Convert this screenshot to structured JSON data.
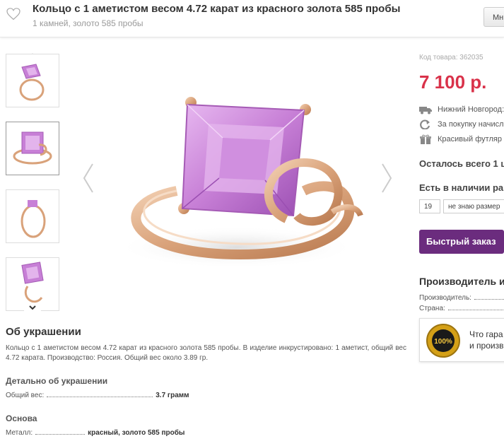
{
  "header": {
    "title": "Кольцо с 1 аметистом весом 4.72 карат из красного золота 585 пробы",
    "subtitle": "1 камней, золото 585 пробы",
    "button_label": "Мн"
  },
  "about": {
    "title": "Об украшении",
    "description": "Кольцо с 1 аметистом весом 4.72 карат из красного золота 585 пробы. В изделие инкрустировано: 1 аметист, общий вес 4.72 карата. Производство: Россия. Общий вес около 3.89 гр.",
    "details_title": "Детально об украшении",
    "weight_label": "Общий вес:",
    "weight_value": "3.7 грамм",
    "base_title": "Основа",
    "metal_label": "Металл:",
    "metal_value": "красный, золото 585 пробы"
  },
  "product": {
    "code": "Код товара: 362035",
    "price": "7 100 р.",
    "features": [
      {
        "icon": "truck-icon",
        "text": "Нижний Новгород:"
      },
      {
        "icon": "refresh-icon",
        "text": "За покупку начисл"
      },
      {
        "icon": "gift-icon",
        "text": "Красивый футляр"
      }
    ],
    "remaining": "Осталось всего 1 ш",
    "availability": "Есть в наличии ра",
    "size_value": "19",
    "size_unknown": "не знаю размер",
    "quick_order": "Быстрый заказ"
  },
  "manufacturer": {
    "title": "Производитель и",
    "producer_label": "Производитель:",
    "country_label": "Страна:"
  },
  "guarantee": {
    "line1": "Что гара",
    "line2": "и произв",
    "seal_text": "100%"
  },
  "colors": {
    "price": "#d9324a",
    "button": "#6b2c7e",
    "stone": "#c77fd6",
    "gold": "#d9a27a"
  }
}
